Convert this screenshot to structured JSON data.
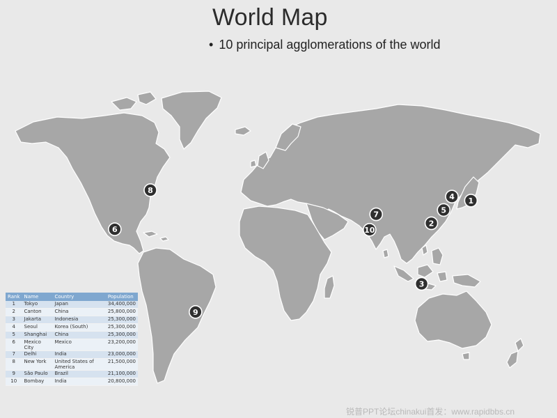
{
  "slide": {
    "title": "World Map",
    "subtitle": "10 principal agglomerations of the world"
  },
  "markers": [
    {
      "rank": "1",
      "lon": 139.7,
      "lat": 35.7
    },
    {
      "rank": "2",
      "lon": 113.3,
      "lat": 23.1
    },
    {
      "rank": "3",
      "lon": 106.8,
      "lat": -6.2
    },
    {
      "rank": "4",
      "lon": 127.0,
      "lat": 37.6
    },
    {
      "rank": "5",
      "lon": 121.5,
      "lat": 31.2
    },
    {
      "rank": "6",
      "lon": -99.1,
      "lat": 19.4
    },
    {
      "rank": "7",
      "lon": 77.2,
      "lat": 28.6
    },
    {
      "rank": "8",
      "lon": -74.0,
      "lat": 40.7
    },
    {
      "rank": "9",
      "lon": -46.6,
      "lat": -23.5
    },
    {
      "rank": "10",
      "lon": 72.9,
      "lat": 19.1
    }
  ],
  "table": {
    "headers": [
      "Rank",
      "Name",
      "Country",
      "Population"
    ],
    "rows": [
      [
        "1",
        "Tokyo",
        "Japan",
        "34,400,000"
      ],
      [
        "2",
        "Canton",
        "China",
        "25,800,000"
      ],
      [
        "3",
        "Jakarta",
        "Indonesia",
        "25,300,000"
      ],
      [
        "4",
        "Seoul",
        "Korea (South)",
        "25,300,000"
      ],
      [
        "5",
        "Shanghai",
        "China",
        "25,300,000"
      ],
      [
        "6",
        "Mexico City",
        "Mexico",
        "23,200,000"
      ],
      [
        "7",
        "Delhi",
        "India",
        "23,000,000"
      ],
      [
        "8",
        "New York",
        "United States of America",
        "21,500,000"
      ],
      [
        "9",
        "São Paulo",
        "Brazil",
        "21,100,000"
      ],
      [
        "10",
        "Bombay",
        "India",
        "20,800,000"
      ]
    ]
  },
  "watermark": "锐普PPT论坛chinakui首发：www.rapidbbs.cn",
  "colors": {
    "land": "#a7a7a7",
    "marker": "#2f2f2f",
    "table_header": "#7fa7cf"
  }
}
